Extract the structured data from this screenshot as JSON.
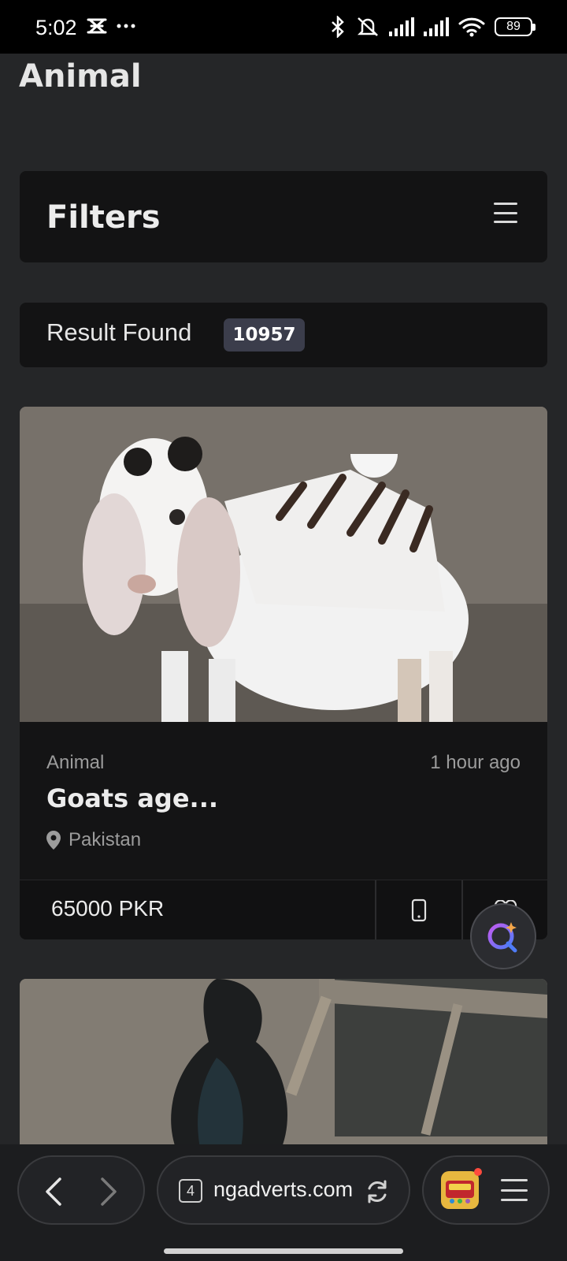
{
  "status_bar": {
    "time": "5:02",
    "battery": "89",
    "icons": [
      "notification-icon",
      "more-dots-icon",
      "bluetooth-icon",
      "mute-icon",
      "signal-icon",
      "signal-icon",
      "wifi-icon",
      "battery-icon"
    ]
  },
  "page": {
    "title": "Animal",
    "filters_label": "Filters",
    "result_label": "Result Found",
    "result_count": "10957"
  },
  "listing": {
    "category": "Animal",
    "time": "1 hour ago",
    "title": "Goats age...",
    "location": "Pakistan",
    "price": "65000 PKR"
  },
  "browser": {
    "tab_count": "4",
    "url": "ngadverts.com"
  },
  "colors": {
    "background": "#252628",
    "card": "#141415",
    "badge": "#3b3d4b"
  }
}
